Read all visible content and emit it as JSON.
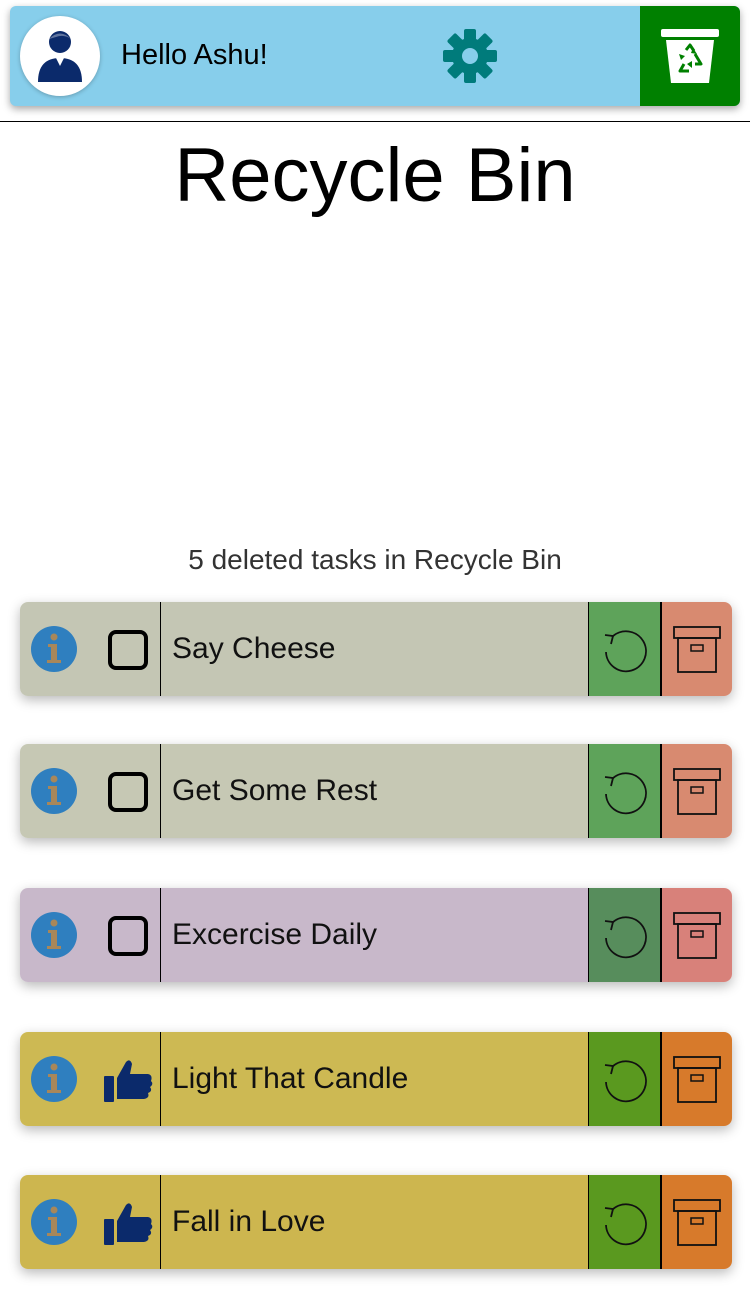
{
  "header": {
    "greeting": "Hello Ashu!",
    "avatar_icon": "user-avatar-icon",
    "settings_icon": "gear-icon",
    "bin_icon": "recycle-bin-icon",
    "colors": {
      "bar": "#87ceeb",
      "bin_button": "#008000",
      "gear": "#007b7b",
      "avatar": "#0b2a6b"
    }
  },
  "page": {
    "title": "Recycle Bin",
    "count_text": "5 deleted tasks in Recycle Bin"
  },
  "tasks": [
    {
      "label": "Say Cheese",
      "status": "checkbox",
      "body_color": "#c4c6b4",
      "restore_color": "#5ea35a",
      "archive_color": "#d88a70"
    },
    {
      "label": "Get Some Rest",
      "status": "checkbox",
      "body_color": "#c6c8b4",
      "restore_color": "#5ea35a",
      "archive_color": "#d88a70"
    },
    {
      "label": "Excercise Daily",
      "status": "checkbox",
      "body_color": "#c8b8ca",
      "restore_color": "#578d5c",
      "archive_color": "#d8817a"
    },
    {
      "label": "Light That Candle",
      "status": "thumbs-up",
      "body_color": "#cdb953",
      "restore_color": "#5a991f",
      "archive_color": "#d77a2b"
    },
    {
      "label": "Fall in Love",
      "status": "thumbs-up",
      "body_color": "#cdb64f",
      "restore_color": "#5a991f",
      "archive_color": "#d77a2b"
    }
  ]
}
